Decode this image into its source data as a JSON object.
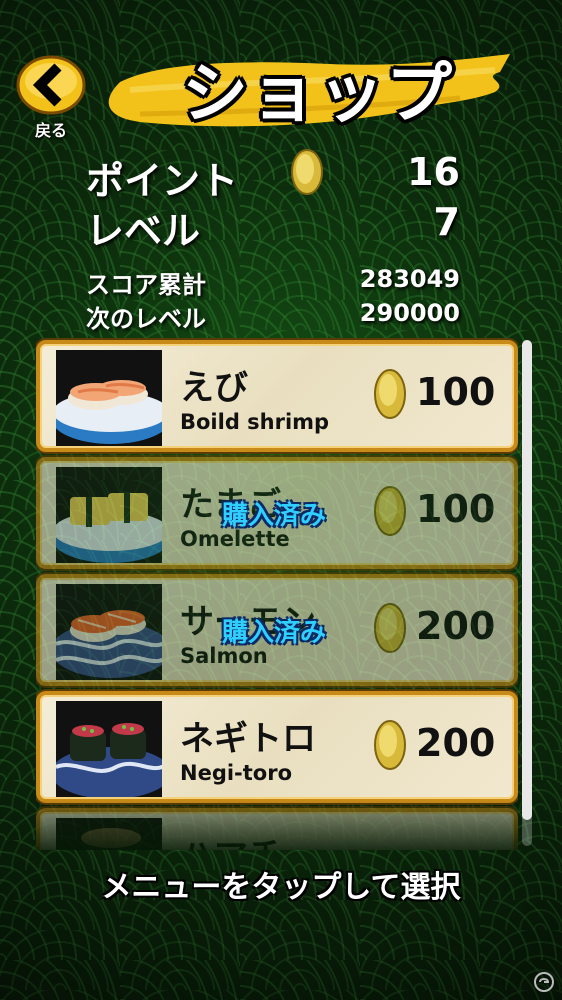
{
  "header": {
    "back_label": "戻る",
    "title": "ショップ"
  },
  "stats": {
    "points_label": "ポイント",
    "points_value": "16",
    "level_label": "レベル",
    "level_value": "7",
    "total_score_label": "スコア累計",
    "total_score_value": "283049",
    "next_level_label": "次のレベル",
    "next_level_value": "290000"
  },
  "shop_items": [
    {
      "name_jp": "えび",
      "name_en": "Boild shrimp",
      "price": "100",
      "purchased_label": "",
      "dim": false,
      "thumb": "shrimp"
    },
    {
      "name_jp": "たまご",
      "name_en": "Omelette",
      "price": "100",
      "purchased_label": "購入済み",
      "dim": true,
      "thumb": "omelette"
    },
    {
      "name_jp": "サーモン",
      "name_en": "Salmon",
      "price": "200",
      "purchased_label": "購入済み",
      "dim": true,
      "thumb": "salmon"
    },
    {
      "name_jp": "ネギトロ",
      "name_en": "Negi-toro",
      "price": "200",
      "purchased_label": "",
      "dim": false,
      "thumb": "negitoro"
    },
    {
      "name_jp": "ハマチ",
      "name_en": "",
      "price": "",
      "purchased_label": "",
      "dim": true,
      "thumb": "partial"
    }
  ],
  "footer": {
    "instruction": "メニューをタップして選択"
  },
  "colors": {
    "gold_border": "#c88a18",
    "purchased_text": "#2fd0ff",
    "banner_yellow": "#f2c21a"
  },
  "icons": {
    "back": "chevron-left-icon",
    "coin": "gold-coin-icon",
    "watermark": "site-logo-icon"
  }
}
